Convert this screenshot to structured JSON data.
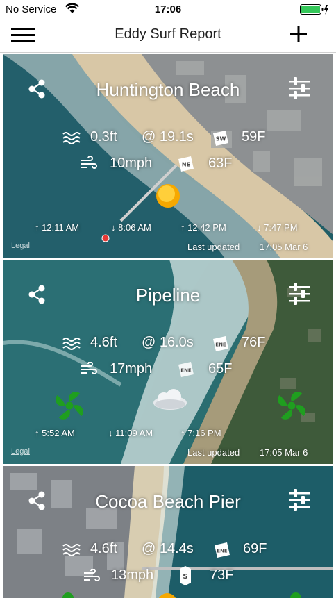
{
  "status_bar": {
    "carrier": "No Service",
    "time": "17:06"
  },
  "nav": {
    "title": "Eddy Surf Report"
  },
  "spots": [
    {
      "name": "Huntington Beach",
      "swell_height": "0.3ft",
      "swell_period": "@ 19.1s",
      "swell_direction": "SW",
      "water_temp": "59F",
      "wind_speed": "10mph",
      "wind_direction": "NE",
      "air_temp": "63F",
      "tides": [
        {
          "dir": "up",
          "time": "12:11 AM"
        },
        {
          "dir": "down",
          "time": "8:06 AM"
        },
        {
          "dir": "up",
          "time": "12:42 PM"
        },
        {
          "dir": "down",
          "time": "7:47 PM"
        }
      ],
      "last_updated_label": "Last updated",
      "last_updated": "17:05 Mar 6",
      "legal": "Legal"
    },
    {
      "name": "Pipeline",
      "swell_height": "4.6ft",
      "swell_period": "@ 16.0s",
      "swell_direction": "ENE",
      "water_temp": "76F",
      "wind_speed": "17mph",
      "wind_direction": "ENE",
      "air_temp": "65F",
      "tides": [
        {
          "dir": "up",
          "time": "5:52 AM"
        },
        {
          "dir": "down",
          "time": "11:09 AM"
        },
        {
          "dir": "up",
          "time": "7:16 PM"
        }
      ],
      "last_updated_label": "Last updated",
      "last_updated": "17:05 Mar 6",
      "legal": "Legal"
    },
    {
      "name": "Cocoa Beach Pier",
      "swell_height": "4.6ft",
      "swell_period": "@ 14.4s",
      "swell_direction": "ENE",
      "water_temp": "69F",
      "wind_speed": "13mph",
      "wind_direction": "S",
      "air_temp": "73F"
    }
  ],
  "colors": {
    "wind_fan": "#1f9e1f",
    "sun": "#f6a800",
    "accent": "#000000"
  }
}
